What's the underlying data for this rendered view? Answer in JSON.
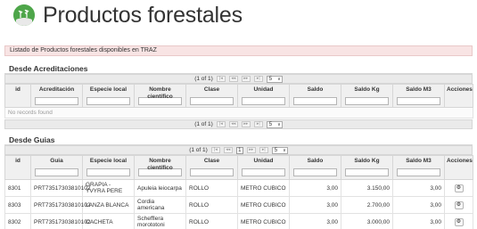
{
  "header": {
    "title": "Productos forestales"
  },
  "banner": {
    "text": "Listado de Productos forestales disponibles en TRAZ"
  },
  "acreditaciones": {
    "title": "Desde Acreditaciones",
    "paginator": {
      "current": "(1 of 1)",
      "first": "|◂",
      "prev": "◂◂",
      "next": "▸▸",
      "last": "▸|",
      "rows": "5"
    },
    "columns": [
      "id",
      "Acreditación",
      "Especie local",
      "Nombre científico",
      "Clase",
      "Unidad",
      "Saldo",
      "Saldo Kg",
      "Saldo M3",
      "Acciones"
    ],
    "empty_message": "No records found"
  },
  "guias": {
    "title": "Desde Guias",
    "paginator": {
      "current": "(1 of 1)",
      "first": "|◂",
      "prev": "◂◂",
      "page": "1",
      "next": "▸▸",
      "last": "▸|",
      "rows": "5"
    },
    "columns": [
      "id",
      "Guia",
      "Especie local",
      "Nombre científico",
      "Clase",
      "Unidad",
      "Saldo",
      "Saldo Kg",
      "Saldo M3",
      "Acciones"
    ],
    "rows": [
      {
        "id": "8301",
        "guia": "PRT73517303810102",
        "especie": "GRAPIA - YVYRA PERE",
        "cientifico": "Apuleia leiocarpa",
        "clase": "ROLLO",
        "unidad": "METRO CUBICO",
        "saldo": "3,00",
        "saldo_kg": "3.150,00",
        "saldo_m3": "3,00"
      },
      {
        "id": "8303",
        "guia": "PRT73517303810102",
        "especie": "LANZA BLANCA",
        "cientifico": "Cordia americana",
        "clase": "ROLLO",
        "unidad": "METRO CUBICO",
        "saldo": "3,00",
        "saldo_kg": "2.700,00",
        "saldo_m3": "3,00"
      },
      {
        "id": "8302",
        "guia": "PRT73517303810102",
        "especie": "CACHETA",
        "cientifico": "Schefflera morototoni",
        "clase": "ROLLO",
        "unidad": "METRO CUBICO",
        "saldo": "3,00",
        "saldo_kg": "3.000,00",
        "saldo_m3": "3,00"
      }
    ]
  },
  "icons": {
    "logo": "forest-logo-icon",
    "action": "gear-icon"
  },
  "colors": {
    "banner_bg": "#f8e4e4",
    "logo_green": "#4ea64a"
  }
}
